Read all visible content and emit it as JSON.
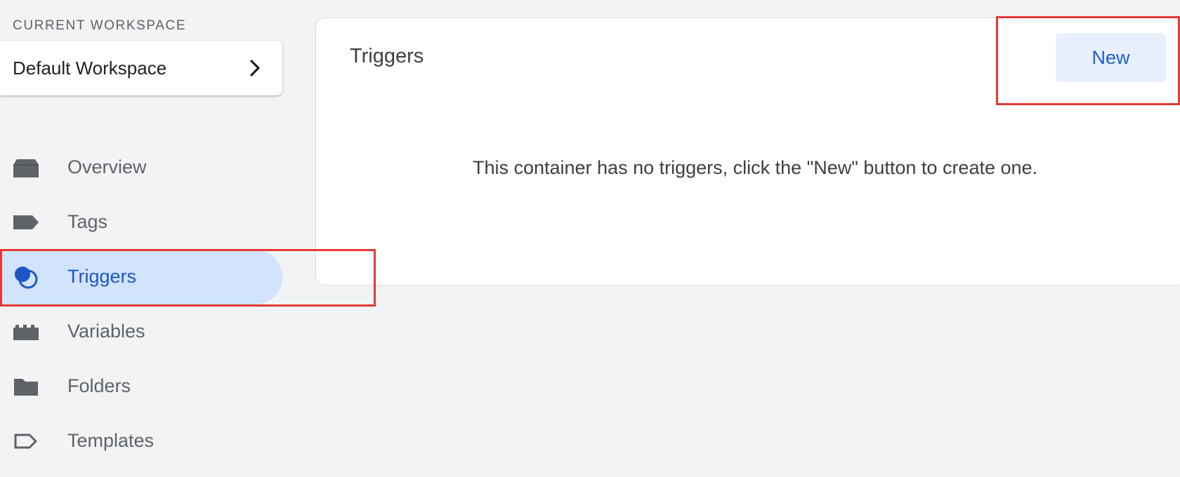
{
  "sidebar": {
    "workspace_label": "CURRENT WORKSPACE",
    "workspace_name": "Default Workspace",
    "items": [
      {
        "label": "Overview",
        "icon": "overview-icon",
        "active": false
      },
      {
        "label": "Tags",
        "icon": "tag-icon",
        "active": false
      },
      {
        "label": "Triggers",
        "icon": "trigger-icon",
        "active": true
      },
      {
        "label": "Variables",
        "icon": "variables-icon",
        "active": false
      },
      {
        "label": "Folders",
        "icon": "folder-icon",
        "active": false
      },
      {
        "label": "Templates",
        "icon": "template-icon",
        "active": false
      }
    ]
  },
  "main": {
    "title": "Triggers",
    "new_button_label": "New",
    "empty_message": "This container has no triggers, click the \"New\" button to create one."
  },
  "colors": {
    "background": "#f1f3f4",
    "accent": "#1a57c8",
    "active_nav_bg": "#d2e3fc",
    "new_button_bg": "#e8f0fe",
    "highlight": "#e53935",
    "icon_gray": "#5f6368"
  }
}
